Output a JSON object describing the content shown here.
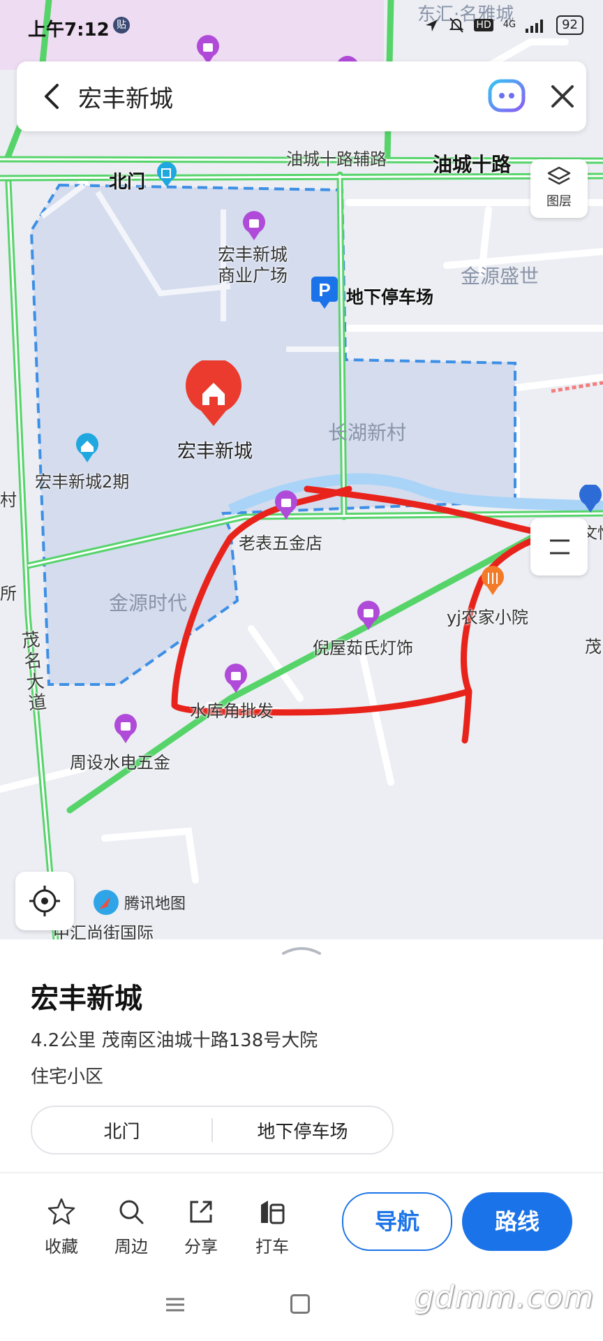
{
  "status_bar": {
    "time": "上午7:12",
    "notif_badge": "贴",
    "network": "4G",
    "hd": "HD",
    "battery": "92"
  },
  "search": {
    "query": "宏丰新城"
  },
  "map": {
    "layers_label": "图层",
    "labels": {
      "road_youcheng_fu": "油城十路辅路",
      "road_youcheng": "油城十路",
      "north_gate": "北门",
      "mall": "宏丰新城\n商业广场",
      "parking": "地下停车场",
      "jinyuan_shengshi": "金源盛世",
      "target": "宏丰新城",
      "changhu": "长湖新村",
      "phase2": "宏丰新城2期",
      "laobiao": "老表五金店",
      "jinyuan_shidai": "金源时代",
      "niwu": "倪屋茹氏灯饰",
      "yj": "yj农家小院",
      "maoming_road": "茂名大道",
      "shuiku": "水库角批发",
      "zhoushe": "周设水电五金",
      "zhonghui": "中汇尚街国际",
      "top_partial": "东汇·名雅城",
      "edge_left1": "村",
      "edge_left2": "所",
      "edge_right1": "茂",
      "edge_right2": "文怡"
    },
    "logo_text": "腾讯地图"
  },
  "place": {
    "name": "宏丰新城",
    "address": "4.2公里   茂南区油城十路138号大院",
    "category": "住宅小区",
    "entrances": [
      "北门",
      "地下停车场"
    ]
  },
  "actions": [
    {
      "label": "收藏",
      "icon": "star-icon"
    },
    {
      "label": "周边",
      "icon": "search-icon"
    },
    {
      "label": "分享",
      "icon": "share-icon"
    },
    {
      "label": "打车",
      "icon": "taxi-icon"
    }
  ],
  "buttons": {
    "navigate": "导航",
    "route": "路线"
  },
  "watermark": "gdmm.com",
  "colors": {
    "accent": "#1a73e8",
    "road_green": "#56d46a",
    "area_border": "#3d8fe6",
    "annotation_red": "#e8231b",
    "poi_purple": "#b04ad8",
    "target_red": "#ea3b2e"
  }
}
